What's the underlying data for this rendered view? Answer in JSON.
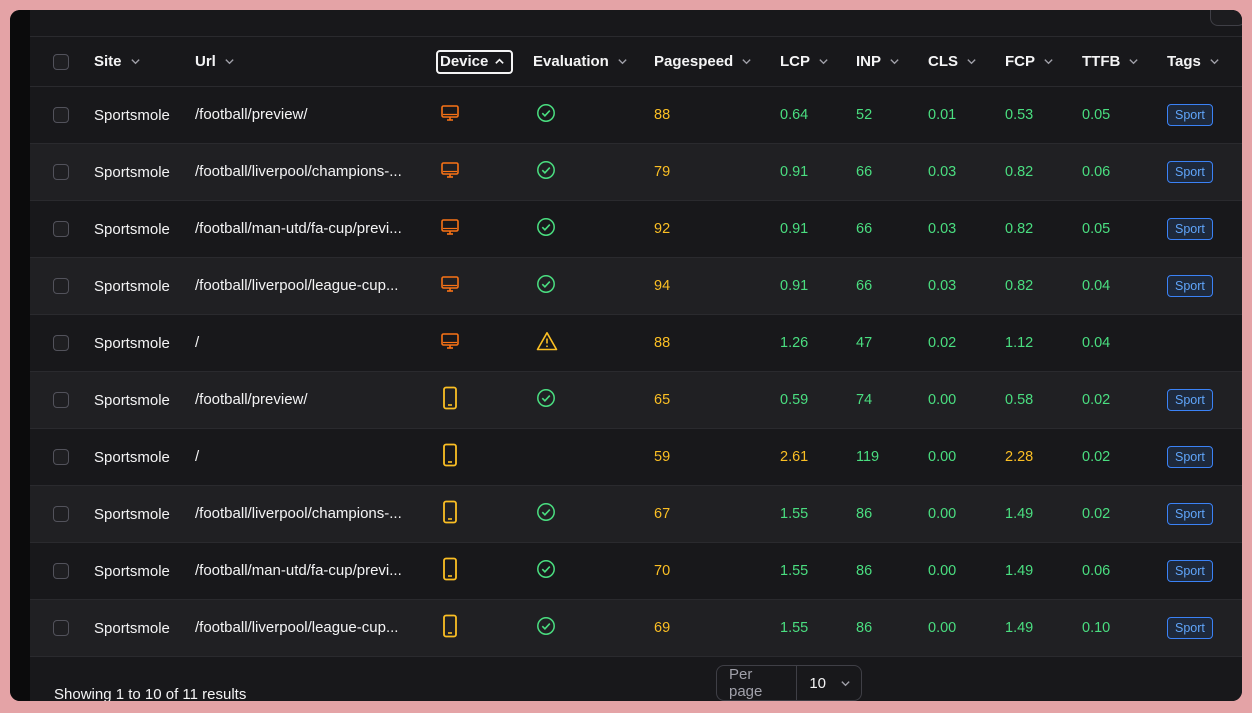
{
  "columns": {
    "site": "Site",
    "url": "Url",
    "device": "Device",
    "evaluation": "Evaluation",
    "pagespeed": "Pagespeed",
    "lcp": "LCP",
    "inp": "INP",
    "cls": "CLS",
    "fcp": "FCP",
    "ttfb": "TTFB",
    "tags": "Tags"
  },
  "colors": {
    "good": "#4ade80",
    "warn": "#fbbf24",
    "desktop_icon": "#f97316",
    "mobile_icon": "#fbbf24"
  },
  "rows": [
    {
      "site": "Sportsmole",
      "url": "/football/preview/",
      "device": "desktop-icon",
      "evaluation": "check-circle-icon",
      "pagespeed": "88",
      "lcp": "0.64",
      "inp": "52",
      "cls": "0.01",
      "fcp": "0.53",
      "ttfb": "0.05",
      "tag": "Sport"
    },
    {
      "site": "Sportsmole",
      "url": "/football/liverpool/champions-...",
      "device": "desktop-icon",
      "evaluation": "check-circle-icon",
      "pagespeed": "79",
      "lcp": "0.91",
      "inp": "66",
      "cls": "0.03",
      "fcp": "0.82",
      "ttfb": "0.06",
      "tag": "Sport"
    },
    {
      "site": "Sportsmole",
      "url": "/football/man-utd/fa-cup/previ...",
      "device": "desktop-icon",
      "evaluation": "check-circle-icon",
      "pagespeed": "92",
      "lcp": "0.91",
      "inp": "66",
      "cls": "0.03",
      "fcp": "0.82",
      "ttfb": "0.05",
      "tag": "Sport"
    },
    {
      "site": "Sportsmole",
      "url": "/football/liverpool/league-cup...",
      "device": "desktop-icon",
      "evaluation": "check-circle-icon",
      "pagespeed": "94",
      "lcp": "0.91",
      "inp": "66",
      "cls": "0.03",
      "fcp": "0.82",
      "ttfb": "0.04",
      "tag": "Sport"
    },
    {
      "site": "Sportsmole",
      "url": "/",
      "device": "desktop-icon",
      "evaluation": "warning-icon",
      "pagespeed": "88",
      "lcp": "1.26",
      "inp": "47",
      "cls": "0.02",
      "fcp": "1.12",
      "ttfb": "0.04",
      "tag": ""
    },
    {
      "site": "Sportsmole",
      "url": "/football/preview/",
      "device": "mobile-icon",
      "evaluation": "check-circle-icon",
      "pagespeed": "65",
      "lcp": "0.59",
      "inp": "74",
      "cls": "0.00",
      "fcp": "0.58",
      "ttfb": "0.02",
      "tag": "Sport"
    },
    {
      "site": "Sportsmole",
      "url": "/",
      "device": "mobile-icon",
      "evaluation": "",
      "pagespeed": "59",
      "lcp": "2.61",
      "inp": "119",
      "cls": "0.00",
      "fcp": "2.28",
      "ttfb": "0.02",
      "tag": "Sport"
    },
    {
      "site": "Sportsmole",
      "url": "/football/liverpool/champions-...",
      "device": "mobile-icon",
      "evaluation": "check-circle-icon",
      "pagespeed": "67",
      "lcp": "1.55",
      "inp": "86",
      "cls": "0.00",
      "fcp": "1.49",
      "ttfb": "0.02",
      "tag": "Sport"
    },
    {
      "site": "Sportsmole",
      "url": "/football/man-utd/fa-cup/previ...",
      "device": "mobile-icon",
      "evaluation": "check-circle-icon",
      "pagespeed": "70",
      "lcp": "1.55",
      "inp": "86",
      "cls": "0.00",
      "fcp": "1.49",
      "ttfb": "0.06",
      "tag": "Sport"
    },
    {
      "site": "Sportsmole",
      "url": "/football/liverpool/league-cup...",
      "device": "mobile-icon",
      "evaluation": "check-circle-icon",
      "pagespeed": "69",
      "lcp": "1.55",
      "inp": "86",
      "cls": "0.00",
      "fcp": "1.49",
      "ttfb": "0.10",
      "tag": "Sport"
    }
  ],
  "footer": {
    "showing": "Showing 1 to 10 of 11 results",
    "per_page_label": "Per page",
    "per_page_value": "10"
  }
}
